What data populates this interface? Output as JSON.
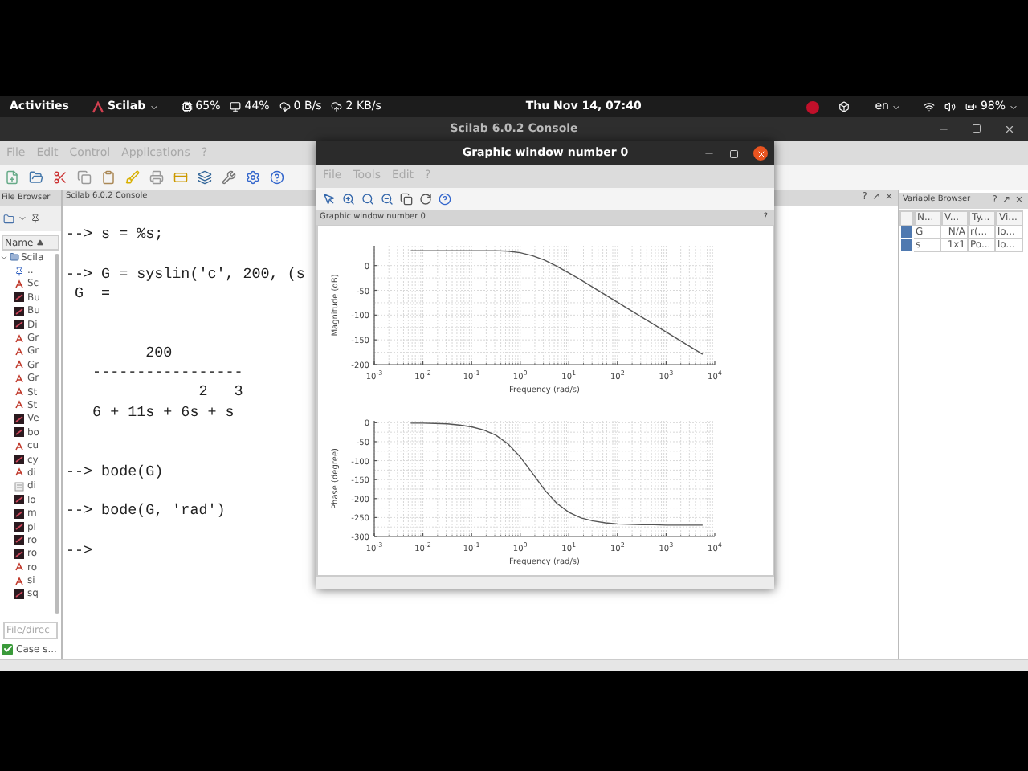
{
  "top_bar": {
    "activities": "Activities",
    "app": "Scilab",
    "cpu": "65%",
    "memory": "44%",
    "download": "0 B/s",
    "upload": "2 KB/s",
    "clock": "Thu Nov 14, 07:40",
    "language": "en",
    "battery": "98%"
  },
  "console_window": {
    "title": "Scilab 6.0.2 Console",
    "menu": [
      "File",
      "Edit",
      "Control",
      "Applications",
      "?"
    ],
    "file_browser": {
      "title": "File Browser",
      "column": "Name",
      "root": {
        "label": "Scila",
        "expanded": true,
        "children": [
          {
            "label": "..",
            "kind": "up"
          },
          {
            "label": "Sc",
            "kind": "pdf"
          },
          {
            "label": "Bu",
            "kind": "script"
          },
          {
            "label": "Bu",
            "kind": "script"
          },
          {
            "label": "Di",
            "kind": "script"
          },
          {
            "label": "Gr",
            "kind": "pdf"
          },
          {
            "label": "Gr",
            "kind": "pdf"
          },
          {
            "label": "Gr",
            "kind": "pdf"
          },
          {
            "label": "Gr",
            "kind": "pdf"
          },
          {
            "label": "St",
            "kind": "pdf"
          },
          {
            "label": "St",
            "kind": "pdf"
          },
          {
            "label": "Ve",
            "kind": "script"
          },
          {
            "label": "bo",
            "kind": "script"
          },
          {
            "label": "cu",
            "kind": "pdf"
          },
          {
            "label": "cy",
            "kind": "script"
          },
          {
            "label": "di",
            "kind": "pdf"
          },
          {
            "label": "di",
            "kind": "text"
          },
          {
            "label": "lo",
            "kind": "script"
          },
          {
            "label": "m",
            "kind": "script"
          },
          {
            "label": "pl",
            "kind": "script"
          },
          {
            "label": "ro",
            "kind": "script"
          },
          {
            "label": "ro",
            "kind": "script"
          },
          {
            "label": "ro",
            "kind": "pdf"
          },
          {
            "label": "si",
            "kind": "pdf"
          },
          {
            "label": "sq",
            "kind": "script"
          }
        ]
      },
      "filter": {
        "placeholder": "File/direc"
      },
      "case_sensitive": {
        "label": "Case s...",
        "checked": true
      }
    },
    "console": {
      "title": "Scilab 6.0.2 Console",
      "dock_buttons": [
        "?",
        "↗",
        "×"
      ],
      "text": "--> s = %s;\n\n--> G = syslin('c', 200, (s\n G  =\n\n\n         200\n   -----------------\n               2   3\n   6 + 11s + 6s + s\n\n\n--> bode(G)\n\n--> bode(G, 'rad')\n\n-->"
    },
    "variable_browser": {
      "title": "Variable Browser",
      "dock_buttons": [
        "?",
        "↗",
        "×"
      ],
      "columns": [
        "N...",
        "V...",
        "Ty...",
        "Vi..."
      ],
      "rows": [
        [
          "G",
          "N/A",
          "r(...",
          "lo..."
        ],
        [
          "s",
          "1x1",
          "Po...",
          "lo..."
        ]
      ]
    }
  },
  "graphic_window": {
    "title": "Graphic window number 0",
    "menu": [
      "File",
      "Tools",
      "Edit",
      "?"
    ],
    "panel_title": "Graphic window number 0",
    "panel_button": "?",
    "charts": [
      {
        "chart_data": {
          "type": "line",
          "xlabel": "Frequency (rad/s)",
          "ylabel": "Magnitude (dB)",
          "categories": [
            "10$^{-3}$",
            null,
            null,
            null,
            "10$^{-2}$",
            null,
            null,
            null,
            "10$^{-1}$",
            null,
            null,
            null,
            "10$^{0}$",
            null,
            null,
            null,
            "10$^{1}$",
            null,
            null,
            null,
            "10$^{2}$",
            null,
            null,
            null,
            "10$^{3}$",
            null,
            null,
            null,
            "10$^{4}$"
          ],
          "values": [
            null,
            null,
            null,
            30,
            30,
            30,
            30,
            30,
            30,
            30,
            30,
            29,
            26,
            20,
            11,
            -1,
            -15,
            -29,
            -44,
            -59,
            -74,
            -89,
            -104,
            -119,
            -134,
            -149,
            -164,
            -179,
            null
          ],
          "ylim": [
            -200,
            40
          ],
          "grid": true,
          "yticks": [
            0,
            -50,
            -100,
            -150,
            -200
          ]
        }
      },
      {
        "chart_data": {
          "type": "line",
          "xlabel": "Frequency (rad/s)",
          "ylabel": "Phase (degree)",
          "categories": [
            "10$^{-3}$",
            null,
            null,
            null,
            "10$^{-2}$",
            null,
            null,
            null,
            "10$^{-1}$",
            null,
            null,
            null,
            "10$^{0}$",
            null,
            null,
            null,
            "10$^{1}$",
            null,
            null,
            null,
            "10$^{2}$",
            null,
            null,
            null,
            "10$^{3}$",
            null,
            null,
            null,
            "10$^{4}$"
          ],
          "values": [
            null,
            null,
            null,
            -1,
            -1,
            -2,
            -3,
            -6,
            -11,
            -19,
            -33,
            -56,
            -90,
            -133,
            -177,
            -212,
            -236,
            -251,
            -259,
            -264,
            -267,
            -268,
            -269,
            -269,
            -270,
            -270,
            -270,
            -270,
            null
          ],
          "ylim": [
            -300,
            5
          ],
          "grid": true,
          "yticks": [
            0,
            -50,
            -100,
            -150,
            -200,
            -250,
            -300
          ]
        }
      }
    ]
  }
}
